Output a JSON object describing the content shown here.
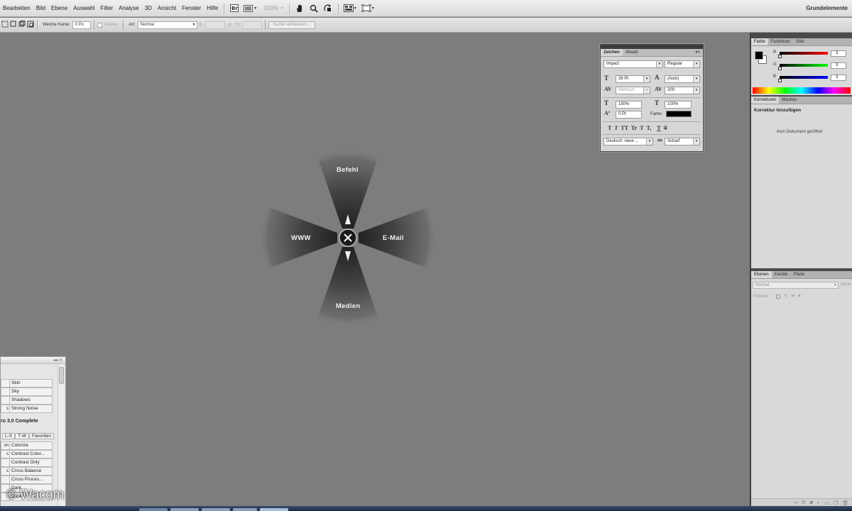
{
  "menubar": {
    "menus": [
      "Bearbeiten",
      "Bild",
      "Ebene",
      "Auswahl",
      "Filter",
      "Analyse",
      "3D",
      "Ansicht",
      "Fenster",
      "Hilfe"
    ],
    "zoom": "100%",
    "workspace": "Grundelemente"
  },
  "options": {
    "feather_label": "Weiche Kante:",
    "feather_value": "0 Px",
    "smooth_label": "Glätten",
    "style_label": "Art:",
    "style_value": "Normal",
    "width_label": "B:",
    "height_label": "H:",
    "refine_button": "Kante verbessern..."
  },
  "zeichen": {
    "tabs": [
      "Zeichen",
      "Absatz"
    ],
    "font_family": "Impact",
    "font_style": "Regular",
    "font_size": "36 Pt",
    "leading": "(Auto)",
    "kerning": "Metrisch",
    "tracking": "200",
    "vscale": "150%",
    "hscale": "100%",
    "baseline": "0 Pt",
    "color_label": "Farbe:",
    "color": "#000000",
    "style_buttons": [
      "T",
      "T",
      "TT",
      "Tr",
      "T",
      "T,",
      "T",
      "T"
    ],
    "language": "Deutsch: neue ...",
    "aa_label": "aa",
    "antialias": "Scharf"
  },
  "radial": {
    "top": "Befehl",
    "left": "WWW",
    "right": "E-Mail",
    "bottom": "Medien"
  },
  "dock": {
    "color_tabs": [
      "Farbe",
      "Farbfelder",
      "Stile"
    ],
    "channels": [
      {
        "label": "R",
        "value": "3"
      },
      {
        "label": "G",
        "value": "3"
      },
      {
        "label": "B",
        "value": "3"
      }
    ],
    "adjust_tabs": [
      "Korrekturen",
      "Masken"
    ],
    "adjust_title": "Korrektur hinzufügen",
    "no_doc": "Kein Dokument geöffnet",
    "layer_tabs": [
      "Ebenen",
      "Kanäle",
      "Pfade"
    ],
    "blend_mode": "Normal",
    "opacity_label": "Deckl",
    "fix_label": "Fixieren:"
  },
  "filter_panel": {
    "rows": [
      {
        "left": "",
        "right": "Skin"
      },
      {
        "left": "",
        "right": "Sky"
      },
      {
        "left": "",
        "right": "Shadows"
      },
      {
        "left": "s",
        "right": "Strong Noise"
      }
    ],
    "title": "ro 3.0 Complete",
    "tabs": [
      "L-S",
      "T-W",
      "Favoriten"
    ],
    "rows2": [
      {
        "left": "on",
        "right": "Colorize"
      },
      {
        "left": "s",
        "right": "Contrast Color..."
      },
      {
        "left": "",
        "right": "Contrast Only"
      },
      {
        "left": "s",
        "right": "Cross Balance"
      },
      {
        "left": "",
        "right": "Cross Proces..."
      },
      {
        "left": "",
        "right": "Dark..."
      },
      {
        "left": "",
        "right": "Duplex"
      }
    ]
  },
  "watermark": "© Wacom"
}
